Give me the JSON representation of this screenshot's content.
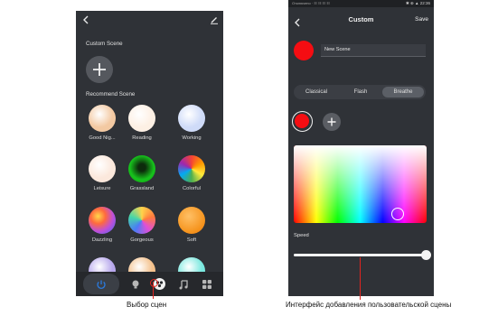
{
  "left": {
    "section_custom": "Custom Scene",
    "section_recommend": "Recommend Scene",
    "back_glyph": "‹",
    "add_glyph": "+",
    "scenes": [
      {
        "label": "Good Nig...",
        "color": "#f3c9a2"
      },
      {
        "label": "Reading",
        "color": "#fdf0e4"
      },
      {
        "label": "Working",
        "color": "#cfdbf8"
      },
      {
        "label": "Leisure",
        "color": "#fbe8dc"
      },
      {
        "label": "Grassland",
        "color": "#19c01f"
      },
      {
        "label": "Colorful",
        "color": "#f4a02a"
      },
      {
        "label": "Dazzling",
        "color": "#c054d8"
      },
      {
        "label": "Gorgeous",
        "color": "#f6c33b"
      },
      {
        "label": "Soft",
        "color": "#f6951f"
      },
      {
        "label": "",
        "color": "#b7a7ec"
      },
      {
        "label": "",
        "color": "#f4c18c"
      },
      {
        "label": "",
        "color": "#7ae8df"
      }
    ],
    "nav_icons": [
      "power-icon",
      "bulb-icon",
      "scene-icon",
      "music-icon",
      "grid-icon"
    ]
  },
  "right": {
    "status_left": "Отключено · ☷ ☷ ☷ ☷",
    "status_right": "✱ ⊕ ▲ 22:36",
    "title": "Custom",
    "save_label": "Save",
    "scene_name_value": "New Scene",
    "modes": [
      "Classical",
      "Flash",
      "Breathe"
    ],
    "selected_mode": "Breathe",
    "selected_color": "#f50d12",
    "add_glyph": "+",
    "speed_label": "Speed",
    "speed_value": 1.0
  },
  "captions": {
    "left": "Выбор сцен",
    "right": "Интерфейс добавления пользовательской сцены"
  },
  "colors": {
    "panel_bg": "#2f3237",
    "accent_blue": "#2a7be0",
    "callout_red": "#e2241f"
  }
}
